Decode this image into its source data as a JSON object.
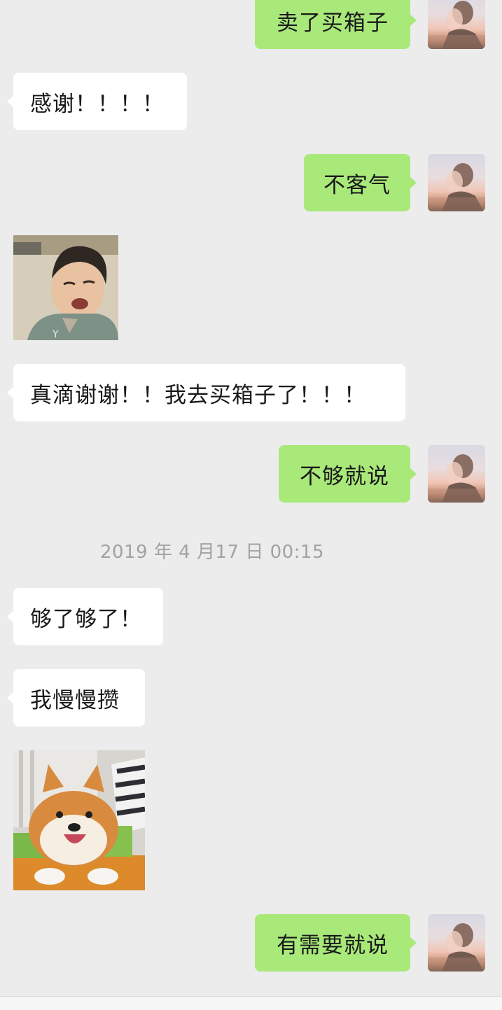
{
  "chat": {
    "messages": [
      {
        "sender": "me",
        "type": "text",
        "text": "卖了买箱子"
      },
      {
        "sender": "them",
        "type": "text",
        "text": "感谢！！！！"
      },
      {
        "sender": "me",
        "type": "text",
        "text": "不客气"
      },
      {
        "sender": "them",
        "type": "sticker",
        "sticker": "crying-child-sticker"
      },
      {
        "sender": "them",
        "type": "text",
        "text": "真滴谢谢！！我去买箱子了！！！"
      },
      {
        "sender": "me",
        "type": "text",
        "text": "不够就说"
      },
      {
        "type": "timestamp",
        "text": "2019 年 4 月17 日 00:15"
      },
      {
        "sender": "them",
        "type": "text",
        "text": "够了够了！"
      },
      {
        "sender": "them",
        "type": "text",
        "text": "我慢慢攒"
      },
      {
        "sender": "them",
        "type": "sticker",
        "sticker": "smiling-shiba-dog-sticker"
      },
      {
        "sender": "me",
        "type": "text",
        "text": "有需要就说"
      }
    ]
  },
  "colors": {
    "background": "#ececec",
    "incoming_bubble": "#ffffff",
    "outgoing_bubble": "#a9e97a",
    "timestamp_text": "#a2a2a2",
    "message_text": "#191919"
  },
  "icons": {
    "my_avatar": "profile-avatar-icon"
  }
}
